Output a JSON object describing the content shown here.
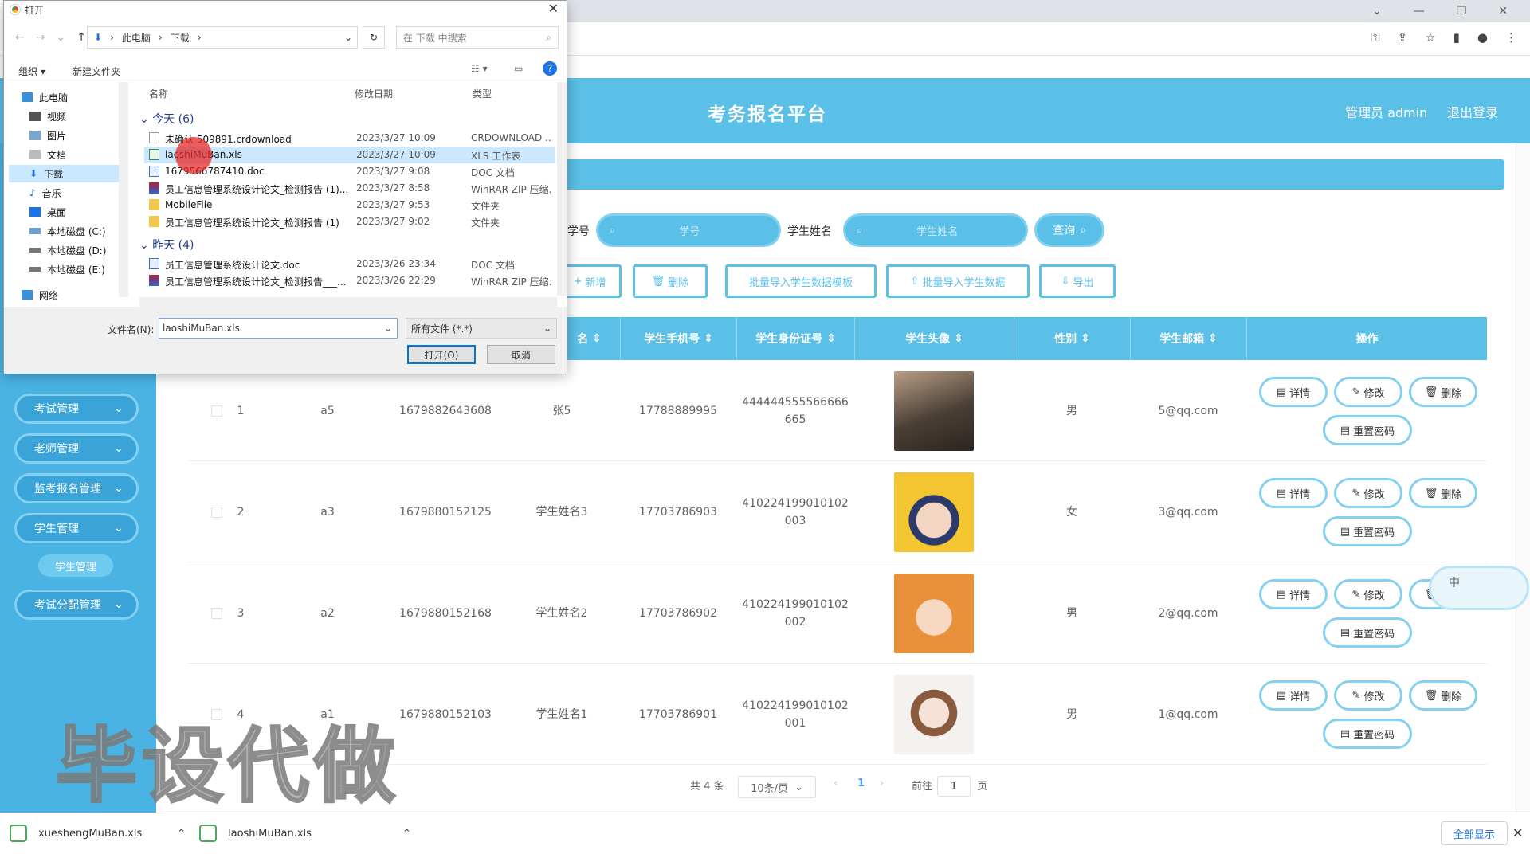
{
  "app": {
    "title": "考务报名平台",
    "user_label": "管理员 admin",
    "logout_label": "退出登录"
  },
  "sidebar": {
    "items": [
      {
        "label": "考试管理"
      },
      {
        "label": "老师管理"
      },
      {
        "label": "监考报名管理"
      },
      {
        "label": "学生管理"
      },
      {
        "label": "考试分配管理"
      }
    ],
    "active_sub": "学生管理"
  },
  "search": {
    "xuehao_label": "学号",
    "xuehao_placeholder": "学号",
    "name_label": "学生姓名",
    "name_placeholder": "学生姓名",
    "query_label": "查询"
  },
  "actions": {
    "add": "新增",
    "delete": "删除",
    "import_template": "批量导入学生数据模板",
    "import": "批量导入学生数据",
    "export": "导出"
  },
  "table": {
    "headers": [
      "名",
      "学生手机号",
      "学生身份证号",
      "学生头像",
      "性别",
      "学生邮箱",
      "操作"
    ],
    "rows": [
      {
        "idx": "1",
        "xuehao": "a5",
        "account": "1679882643608",
        "name": "张5",
        "phone": "17788889995",
        "id_card_1": "444444555566666",
        "id_card_2": "665",
        "sex": "男",
        "email": "5@qq.com"
      },
      {
        "idx": "2",
        "xuehao": "a3",
        "account": "1679880152125",
        "name": "学生姓名3",
        "phone": "17703786903",
        "id_card_1": "410224199010102",
        "id_card_2": "003",
        "sex": "女",
        "email": "3@qq.com"
      },
      {
        "idx": "3",
        "xuehao": "a2",
        "account": "1679880152168",
        "name": "学生姓名2",
        "phone": "17703786902",
        "id_card_1": "410224199010102",
        "id_card_2": "002",
        "sex": "男",
        "email": "2@qq.com"
      },
      {
        "idx": "4",
        "xuehao": "a1",
        "account": "1679880152103",
        "name": "学生姓名1",
        "phone": "17703786901",
        "id_card_1": "410224199010102",
        "id_card_2": "001",
        "sex": "男",
        "email": "1@qq.com"
      }
    ],
    "ops": {
      "detail": "详情",
      "edit": "修改",
      "delete": "删除",
      "reset": "重置密码"
    }
  },
  "pager": {
    "total": "共 4 条",
    "size": "10条/页",
    "current": "1",
    "goto": "前往",
    "page_input": "1",
    "page_unit": "页"
  },
  "downloads": {
    "items": [
      "xueshengMuBan.xls",
      "laoshiMuBan.xls"
    ],
    "show_all": "全部显示"
  },
  "watermark": "毕设代做",
  "float_badge": "中",
  "dialog": {
    "title": "打开",
    "path": [
      "此电脑",
      "下载"
    ],
    "search_placeholder": "在 下载 中搜索",
    "organize": "组织 ▾",
    "new_folder": "新建文件夹",
    "tree": [
      "此电脑",
      "视频",
      "图片",
      "文档",
      "下载",
      "音乐",
      "桌面",
      "本地磁盘 (C:)",
      "本地磁盘 (D:)",
      "本地磁盘 (E:)",
      "网络"
    ],
    "columns": {
      "name": "名称",
      "date": "修改日期",
      "type": "类型"
    },
    "group_today": "今天 (6)",
    "group_yesterday": "昨天 (4)",
    "files_today": [
      {
        "name": "未确认 509891.crdownload",
        "date": "2023/3/27 10:09",
        "type": "CRDOWNLOAD ..."
      },
      {
        "name": "laoshiMuBan.xls",
        "date": "2023/3/27 10:09",
        "type": "XLS 工作表"
      },
      {
        "name": "1679566787410.doc",
        "date": "2023/3/27 9:08",
        "type": "DOC 文档"
      },
      {
        "name": "员工信息管理系统设计论文_检测报告 (1)...",
        "date": "2023/3/27 8:58",
        "type": "WinRAR ZIP 压缩..."
      },
      {
        "name": "MobileFile",
        "date": "2023/3/27 9:53",
        "type": "文件夹"
      },
      {
        "name": "员工信息管理系统设计论文_检测报告 (1)",
        "date": "2023/3/27 9:02",
        "type": "文件夹"
      }
    ],
    "files_yesterday": [
      {
        "name": "员工信息管理系统设计论文.doc",
        "date": "2023/3/26 23:34",
        "type": "DOC 文档"
      },
      {
        "name": "员工信息管理系统设计论文_检测报告___...",
        "date": "2023/3/26 22:29",
        "type": "WinRAR ZIP 压缩..."
      }
    ],
    "filename_label": "文件名(N):",
    "filename_value": "laoshiMuBan.xls",
    "filetype": "所有文件 (*.*)",
    "open": "打开(O)",
    "cancel": "取消"
  }
}
